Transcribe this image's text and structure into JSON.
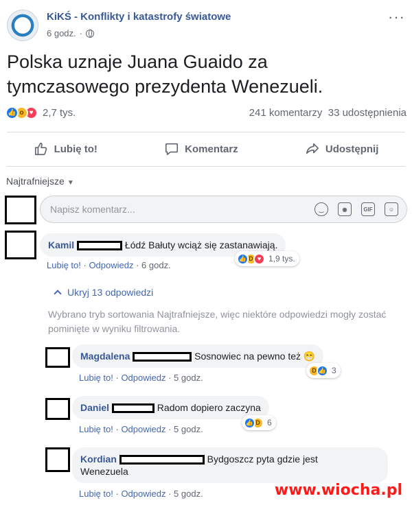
{
  "header": {
    "page_name": "KiKŚ - Konflikty i katastrofy światowe",
    "time": "6 godz.",
    "dot": "·"
  },
  "post": {
    "text": "Polska uznaje Juana Guaido za tymczasowego prezydenta Wenezueli."
  },
  "stats": {
    "reaction_count": "2,7 tys.",
    "comments": "241 komentarzy",
    "shares": "33 udostępnienia"
  },
  "actions": {
    "like": "Lubię to!",
    "comment": "Komentarz",
    "share": "Udostępnij"
  },
  "sort": {
    "label": "Najtrafniejsze"
  },
  "composer": {
    "placeholder": "Napisz komentarz..."
  },
  "comments": [
    {
      "author": "Kamil",
      "text": "Łódź Bałuty wciąż się zastanawiają.",
      "like": "Lubię to!",
      "reply": "Odpowiedz",
      "time": "6 godz.",
      "reaction_count": "1,9 tys."
    }
  ],
  "replies_toggle": "Ukryj 13 odpowiedzi",
  "sort_note": "Wybrano tryb sortowania Najtrafniejsze, więc niektóre odpowiedzi mogły zostać pominięte w wyniku filtrowania.",
  "replies": [
    {
      "author": "Magdalena",
      "text": "Sosnowiec na pewno też 😁",
      "like": "Lubię to!",
      "reply": "Odpowiedz",
      "time": "5 godz.",
      "reaction_count": "3"
    },
    {
      "author": "Daniel",
      "text": "Radom dopiero zaczyna",
      "like": "Lubię to!",
      "reply": "Odpowiedz",
      "time": "5 godz.",
      "reaction_count": "6"
    },
    {
      "author": "Kordian",
      "text": "Bydgoszcz pyta gdzie jest",
      "text2": "Wenezuela",
      "like": "Lubię to!",
      "reply": "Odpowiedz",
      "time": "5 godz."
    }
  ],
  "watermark": "www.wiocha.pl",
  "colors": {
    "link": "#385898",
    "like_blue": "#1877f2",
    "love_red": "#f33e58",
    "wow_yellow": "#f7b928"
  }
}
